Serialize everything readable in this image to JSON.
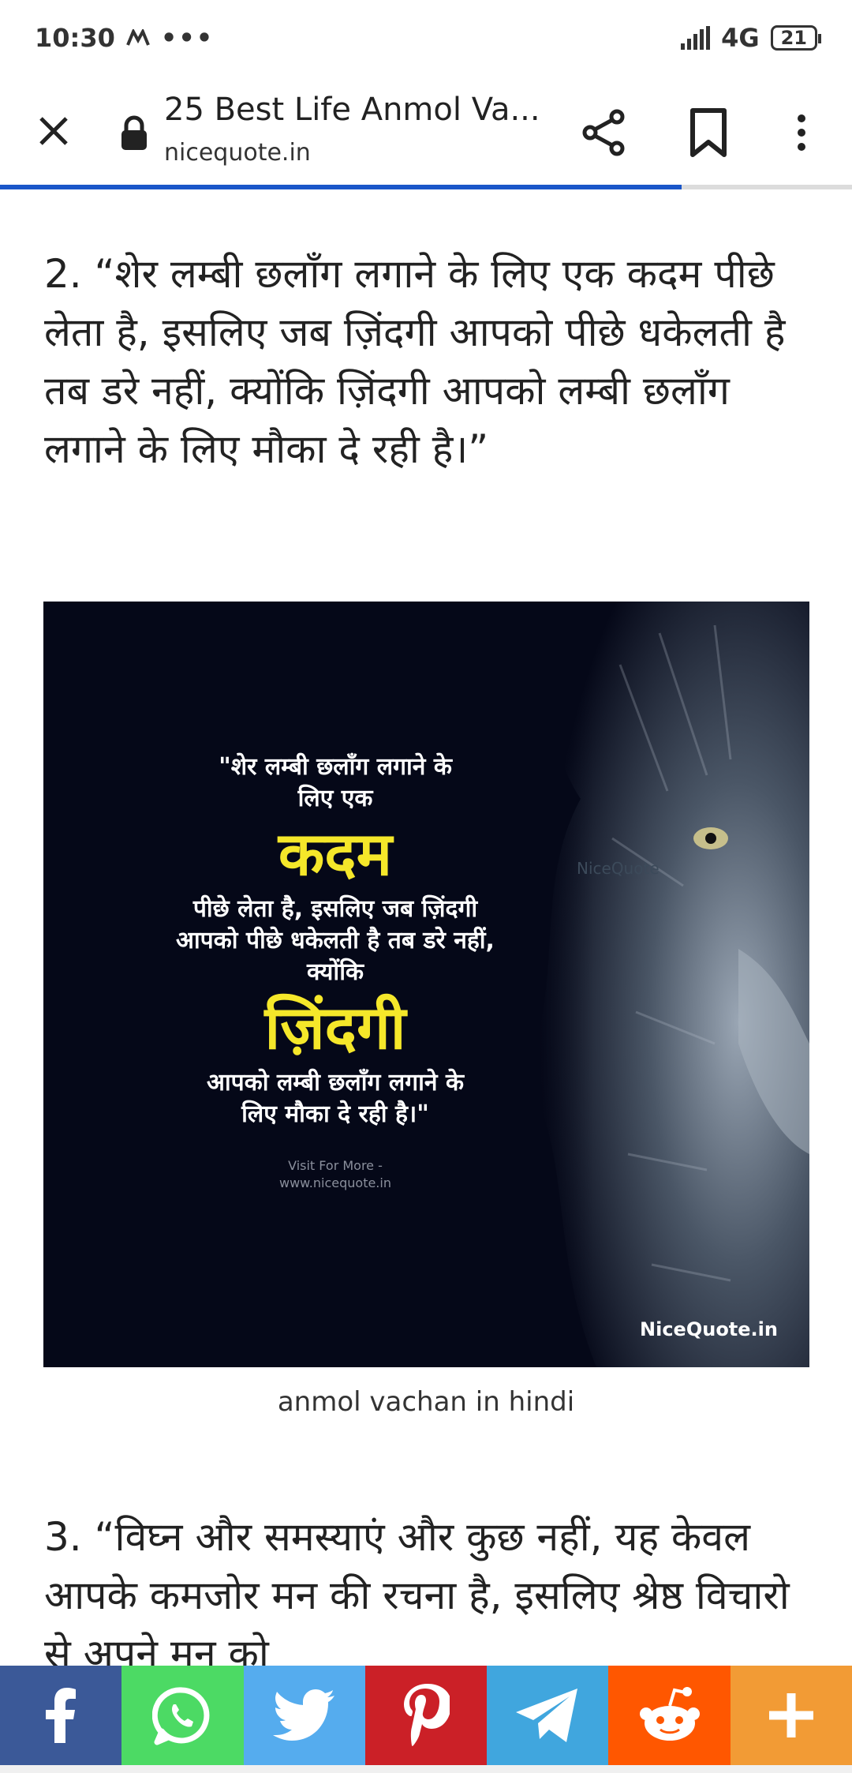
{
  "status_bar": {
    "time": "10:30",
    "network": "4G",
    "battery": "21"
  },
  "toolbar": {
    "title": "25 Best Life Anmol Va...",
    "url": "nicequote.in",
    "load_progress": 0.8
  },
  "article": {
    "quote2": "2. “शेर लम्बी छलाँग लगाने के लिए एक कदम पीछे लेता है, इसलिए जब ज़िंदगी आपको पीछे धकेलती है तब डरे नहीं, क्योंकि ज़िंदगी आपको लम्बी छलाँग लगाने के लिए मौका दे रही है।”",
    "image": {
      "lines_top": [
        "\"शेर लम्बी छलाँग लगाने के",
        "लिए एक"
      ],
      "highlight1": "कदम",
      "lines_mid": [
        "पीछे लेता है, इसलिए जब ज़िंदगी",
        "आपको पीछे धकेलती है तब डरे नहीं,",
        "क्योंकि"
      ],
      "highlight2": "ज़िंदगी",
      "lines_bottom": [
        "आपको लम्बी छलाँग लगाने के",
        "लिए मौका दे रही है।\""
      ],
      "visit_1": "Visit For More -",
      "visit_2": "www.nicequote.in",
      "watermark": "NiceQuote",
      "brand": "NiceQuote.in"
    },
    "caption": "anmol vachan in hindi",
    "quote3": "3. “विघ्न और समस्याएं और कुछ नहीं, यह केवल आपके कमजोर मन की रचना है, इसलिए श्रेष्ठ विचारो से अपने मन को"
  },
  "share_bar": [
    {
      "name": "facebook",
      "color": "#3b5998",
      "icon": "facebook-icon"
    },
    {
      "name": "whatsapp",
      "color": "#4cda64",
      "icon": "whatsapp-icon"
    },
    {
      "name": "twitter",
      "color": "#55acee",
      "icon": "twitter-icon"
    },
    {
      "name": "pinterest",
      "color": "#cb2027",
      "icon": "pinterest-icon"
    },
    {
      "name": "telegram",
      "color": "#40a6de",
      "icon": "telegram-icon"
    },
    {
      "name": "reddit",
      "color": "#ff5700",
      "icon": "reddit-icon"
    },
    {
      "name": "more",
      "color": "#f29b35",
      "icon": "plus-icon"
    }
  ]
}
